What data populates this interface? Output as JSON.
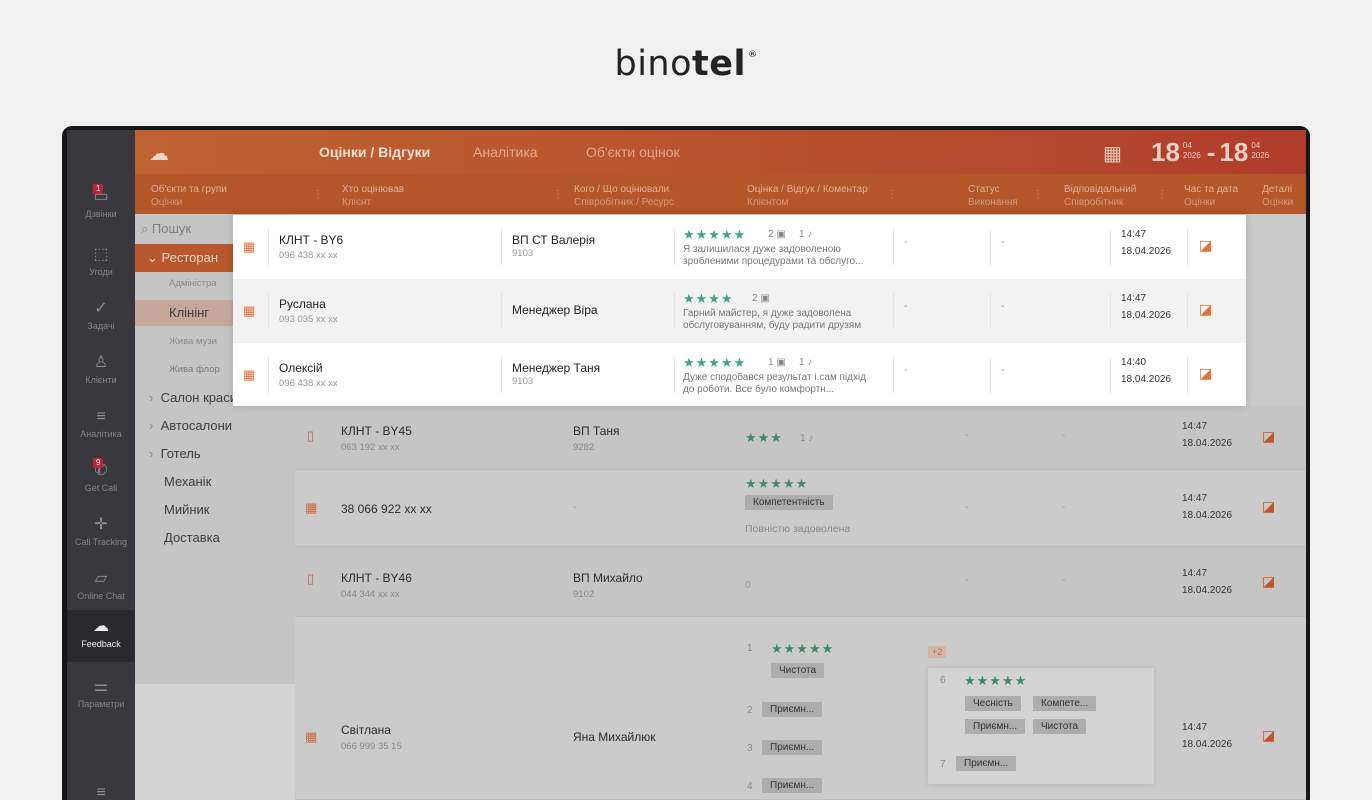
{
  "brand": {
    "name_a": "bino",
    "name_b": "tel",
    "reg": "®"
  },
  "sidebar": {
    "items": [
      {
        "label": "Дзвінки",
        "icon": "calls-icon",
        "badge": "1"
      },
      {
        "label": "Угоди",
        "icon": "deals-icon"
      },
      {
        "label": "Задачі",
        "icon": "tasks-icon"
      },
      {
        "label": "Клієнти",
        "icon": "clients-icon"
      },
      {
        "label": "Аналітика",
        "icon": "analytics-icon"
      },
      {
        "label": "Get Call",
        "icon": "getcall-icon",
        "badge": "9"
      },
      {
        "label": "Call Tracking",
        "icon": "calltracking-icon"
      },
      {
        "label": "Online Chat",
        "icon": "chat-icon"
      },
      {
        "label": "Feedback",
        "icon": "feedback-icon"
      },
      {
        "label": "Параметри",
        "icon": "settings-icon"
      }
    ]
  },
  "header": {
    "tabs": [
      "Оцінки / Відгуки",
      "Аналітика",
      "Об'єкти оцінок"
    ],
    "date_from_day": "18",
    "date_from_m": "04",
    "date_from_y": "2026",
    "date_sep": "-",
    "date_to_day": "18",
    "date_to_m": "04",
    "date_to_y": "2026"
  },
  "columns": [
    {
      "t": "Об'єкти та групи",
      "s": "Оцінки"
    },
    {
      "t": "Хто оцінював",
      "s": "Клієнт"
    },
    {
      "t": "Кого / Що оцінювали",
      "s": "Співробітник / Ресурс"
    },
    {
      "t": "Оцінка / Відгук / Коментар",
      "s": "Клієнтом"
    },
    {
      "t": "Статус",
      "s": "Виконання"
    },
    {
      "t": "Відповідальний",
      "s": "Співробітник"
    },
    {
      "t": "Час та дата",
      "s": "Оцінки"
    },
    {
      "t": "Деталі",
      "s": "Оцінки"
    }
  ],
  "groups": {
    "search_placeholder": "Пошук",
    "items": [
      "Ресторан",
      "Адміністра",
      "Клінінг",
      "Жива музи",
      "Жива флор",
      "Салон краси",
      "Автосалони",
      "Готель",
      "Механік",
      "Мийник",
      "Доставка"
    ]
  },
  "highlight_rows": [
    {
      "client": "КЛНТ - BY6",
      "phone": "096 438 xx xx",
      "staff": "ВП СТ Валерія",
      "staff_id": "9103",
      "stars": "★★★★★",
      "photos": "2",
      "voice": "1",
      "comment": "Я залишилася дуже задоволеною зробленими процедурами та обслуго...",
      "status": "-",
      "resp": "-",
      "time": "14:47",
      "date": "18.04.2026"
    },
    {
      "client": "Руслана",
      "phone": "093 035 xx xx",
      "staff": "Менеджер Віра",
      "staff_id": "",
      "stars": "★★★★",
      "photos": "2",
      "voice": "",
      "comment": "Гарний майстер, я дуже задоволена обслуговуванням, буду радити друзям",
      "status": "-",
      "resp": "-",
      "time": "14:47",
      "date": "18.04.2026"
    },
    {
      "client": "Олексій",
      "phone": "096 438 xx xx",
      "staff": "Менеджер Таня",
      "staff_id": "9103",
      "stars": "★★★★★",
      "photos": "1",
      "voice": "1",
      "comment": "Дуже сподобався результат і сам підхід до роботи. Все було комфортн...",
      "status": "-",
      "resp": "-",
      "time": "14:40",
      "date": "18.04.2026"
    }
  ],
  "rows": [
    {
      "client": "КЛНТ - BY45",
      "phone": "063 192 xx xx",
      "staff": "ВП Таня",
      "staff_id": "9282",
      "stars": "★★★",
      "voice": "1",
      "status": "-",
      "resp": "-",
      "time": "14:47",
      "date": "18.04.2026"
    },
    {
      "client": "38 066 922 xx xx",
      "phone": "",
      "staff": "-",
      "staff_id": "",
      "stars": "★★★★★",
      "tag": "Компетентність",
      "comment": "Повністю задоволена",
      "status": "-",
      "resp": "-",
      "time": "14:47",
      "date": "18.04.2026"
    },
    {
      "client": "КЛНТ - BY46",
      "phone": "044 344 xx xx",
      "staff": "ВП Михайло",
      "staff_id": "9102",
      "score": "0",
      "status": "-",
      "resp": "-",
      "time": "14:47",
      "date": "18.04.2026"
    },
    {
      "client": "Світлана",
      "phone": "066 999 35 15",
      "staff": "Яна Михайлюк",
      "staff_id": "",
      "time": "14:47",
      "date": "18.04.2026"
    }
  ],
  "multi": {
    "n1": "1",
    "stars1": "★★★★★",
    "chip1": "Чистота",
    "n2": "2",
    "chip2": "Приємн...",
    "n3": "3",
    "chip3": "Приємн...",
    "n4": "4",
    "chip4": "Приємн...",
    "plus": "+2"
  },
  "popup": {
    "n6": "6",
    "stars6": "★★★★★",
    "c1": "Чесність",
    "c2": "Компете...",
    "c3": "Приємн...",
    "c4": "Чистота",
    "n7": "7",
    "c5": "Приємн..."
  }
}
